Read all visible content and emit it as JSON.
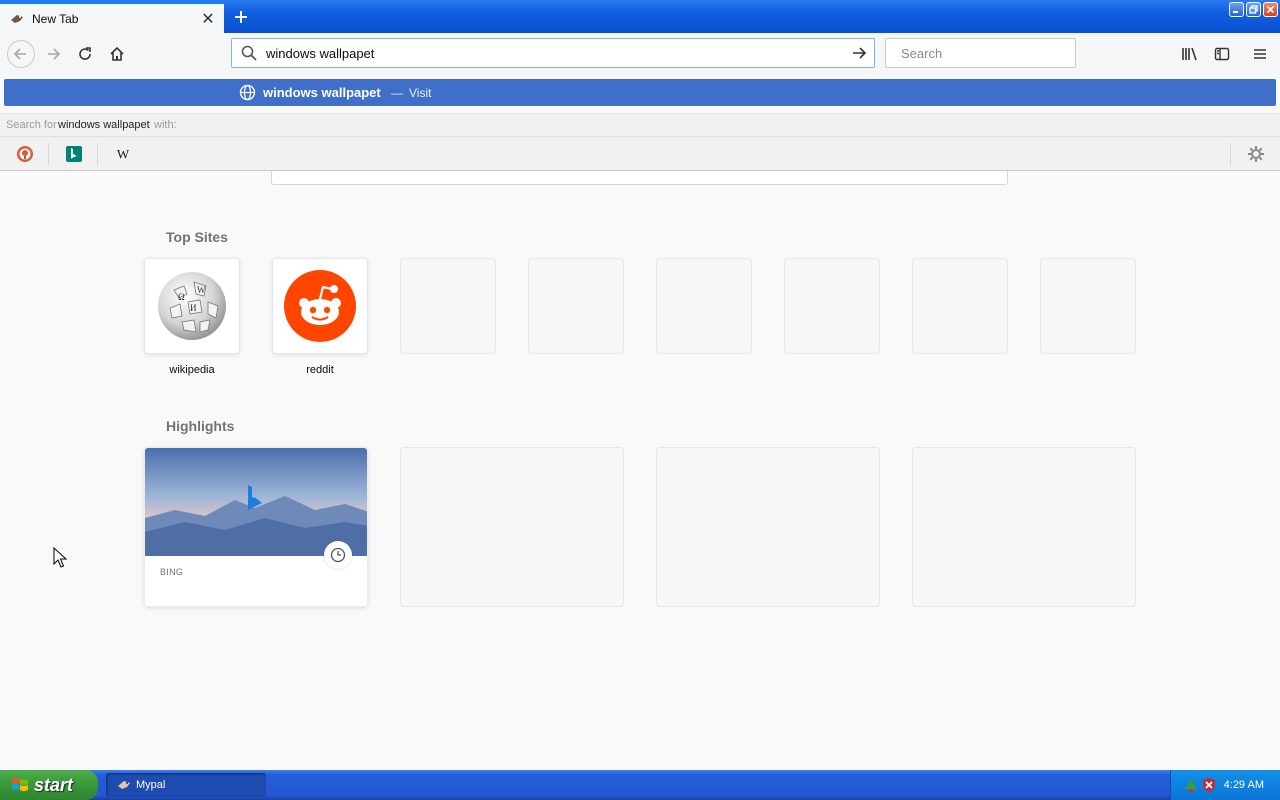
{
  "tab": {
    "title": "New Tab"
  },
  "urlbar": {
    "value": "windows wallpapet"
  },
  "searchbar": {
    "placeholder": "Search"
  },
  "popup": {
    "query": "windows wallpapet",
    "separator": "—",
    "action": "Visit",
    "oneoff_prefix": "Search for",
    "oneoff_query": "windows wallpapet",
    "oneoff_suffix": "with:",
    "engines": [
      "duckduckgo-icon",
      "bing-icon",
      "wikipedia-icon"
    ]
  },
  "top_sites": {
    "title": "Top Sites",
    "items": [
      {
        "label": "wikipedia",
        "icon": "wikipedia-globe-icon"
      },
      {
        "label": "reddit",
        "icon": "reddit-icon"
      }
    ]
  },
  "highlights": {
    "title": "Highlights",
    "cards": [
      {
        "source": "BING",
        "icon": "bing-logo-icon"
      }
    ]
  },
  "taskbar": {
    "start_label": "start",
    "window_label": "Mypal",
    "clock": "4:29 AM"
  },
  "colors": {
    "accent": "#0a84ff",
    "popup_highlight": "#3f6fc9",
    "reddit": "#ff4500",
    "xp_blue": "#245edb",
    "xp_start_green": "#3c9b3c"
  }
}
